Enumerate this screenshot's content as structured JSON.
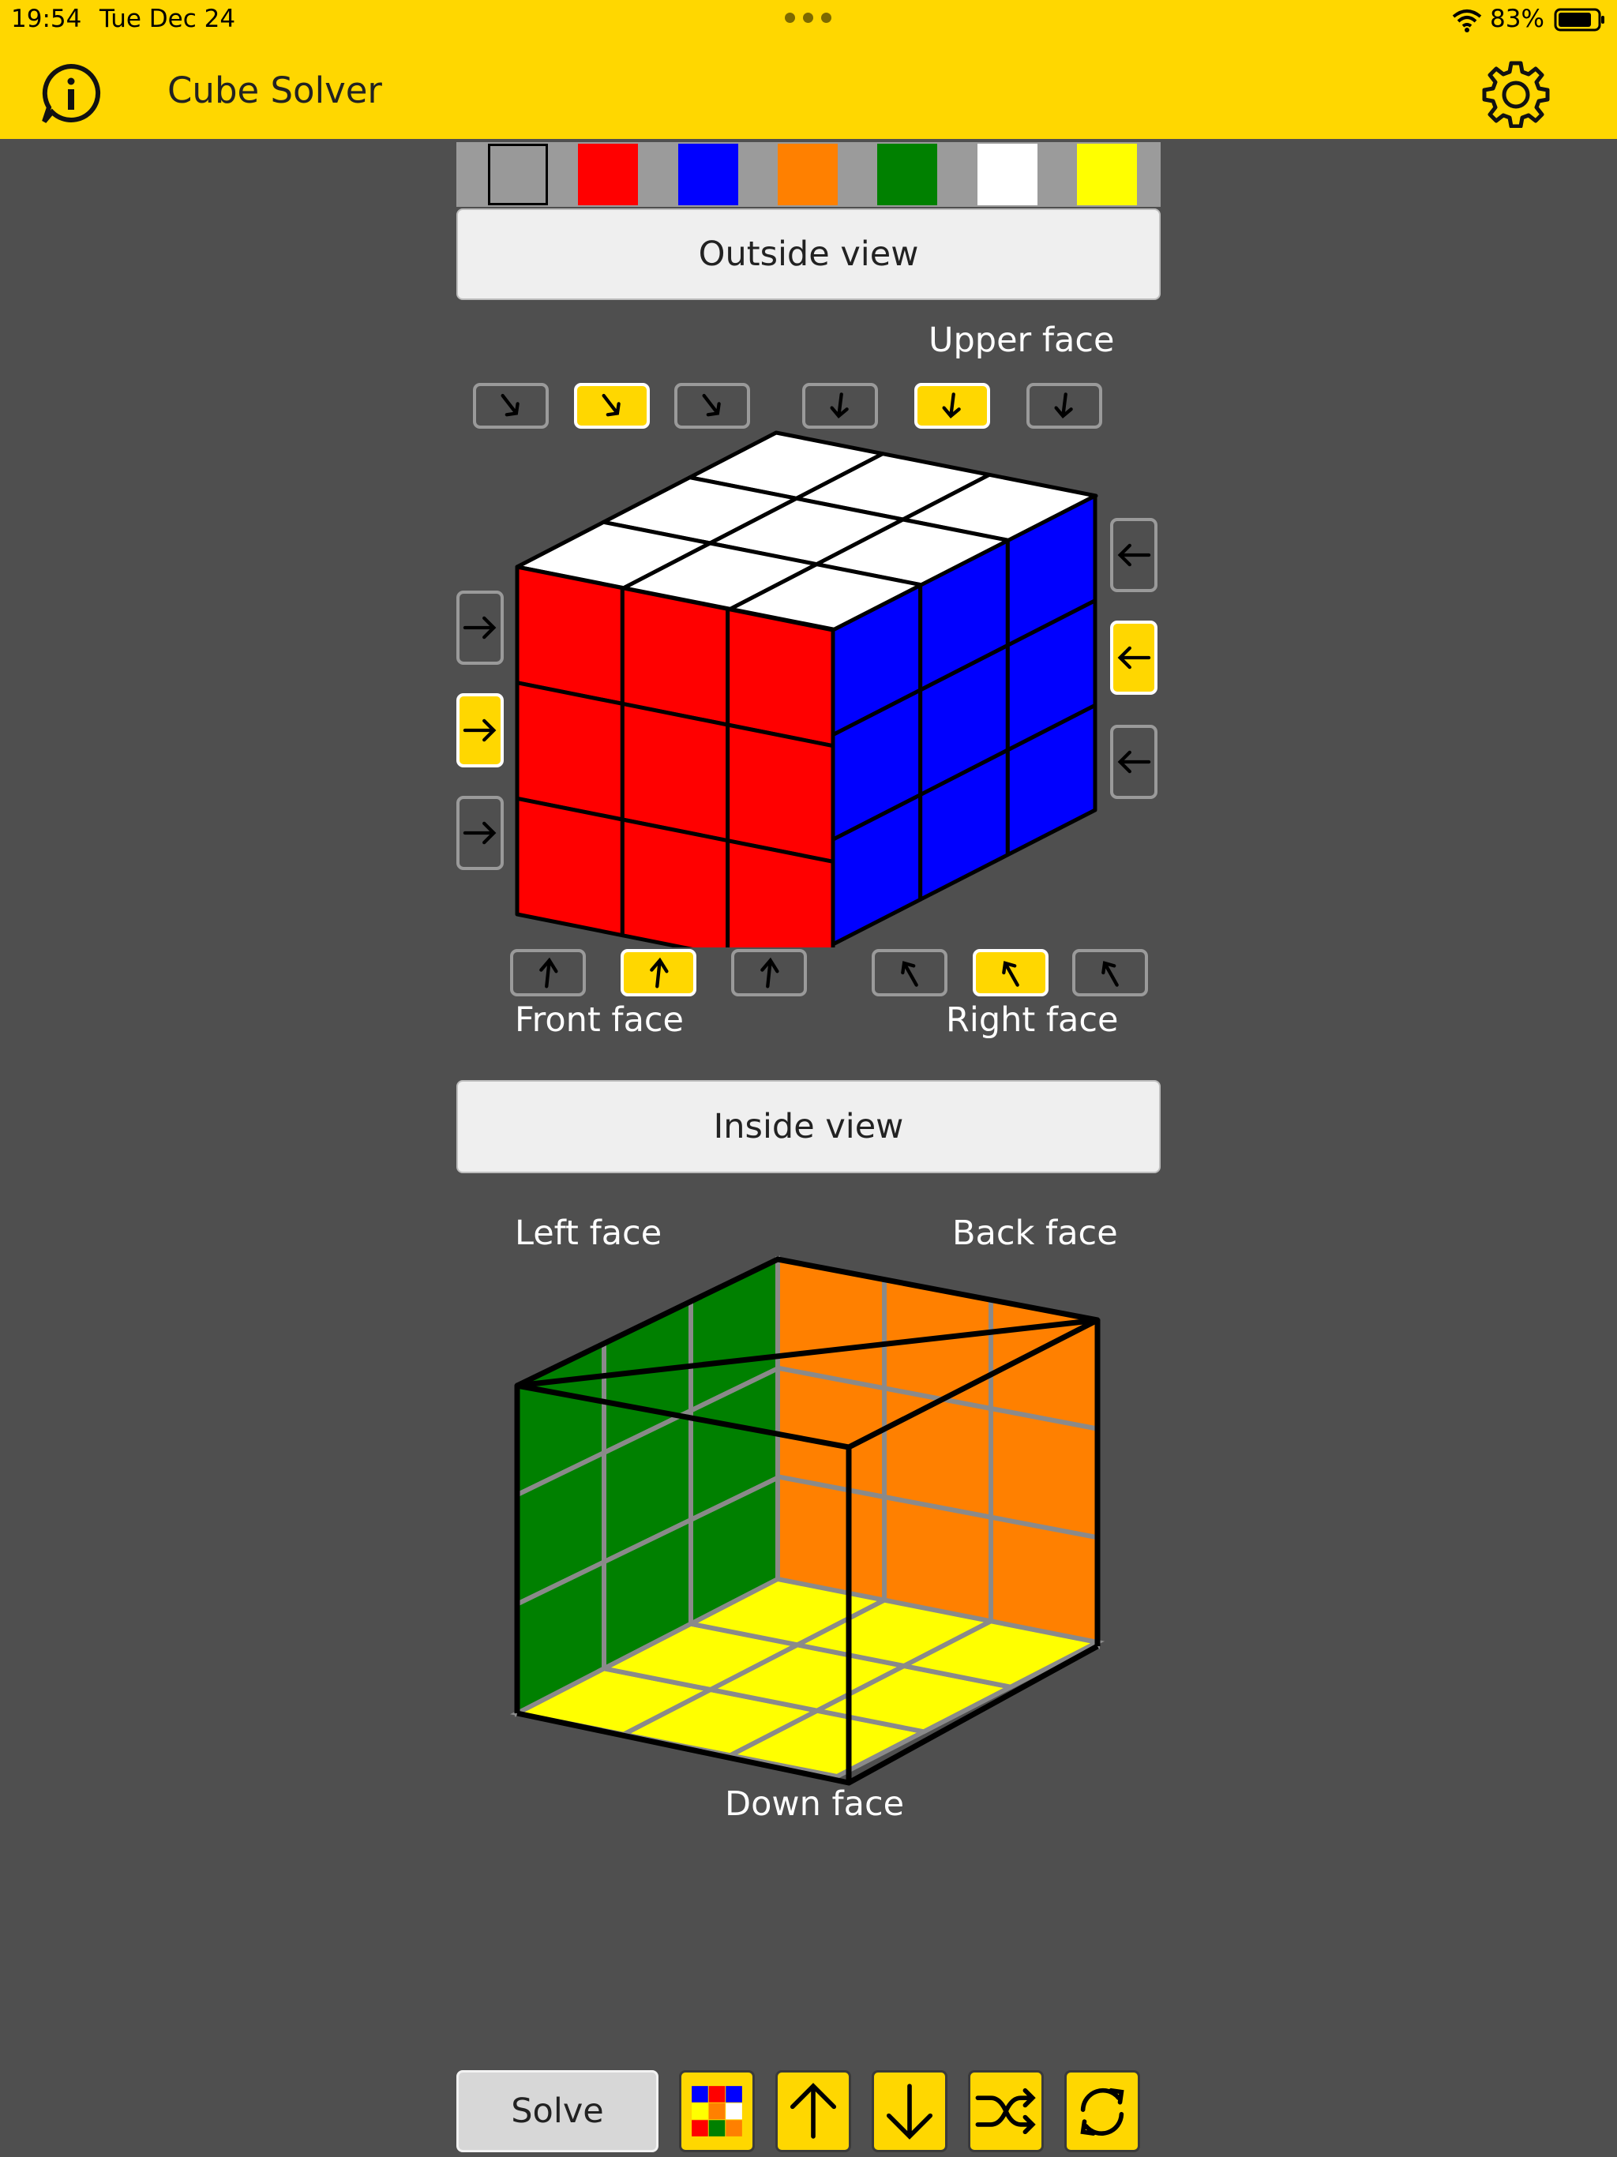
{
  "status_bar": {
    "time": "19:54",
    "date": "Tue Dec 24",
    "battery": "83%"
  },
  "header": {
    "title": "Cube Solver",
    "info_icon": "info-icon",
    "settings_icon": "gear-icon"
  },
  "colors": {
    "accent": "#ffd700",
    "background": "#4f4f4f",
    "palette": [
      "#999999",
      "#ff0000",
      "#0000ff",
      "#ff8000",
      "#008000",
      "#ffffff",
      "#ffff00"
    ]
  },
  "outside_view": {
    "button_label": "Outside view",
    "upper_face_label": "Upper face",
    "front_face_label": "Front face",
    "right_face_label": "Right face",
    "upper_colors": [
      "#ffffff",
      "#ffffff",
      "#ffffff",
      "#ffffff",
      "#ffffff",
      "#ffffff",
      "#ffffff",
      "#ffffff",
      "#ffffff"
    ],
    "front_colors": [
      "#ff0000",
      "#ff0000",
      "#ff0000",
      "#ff0000",
      "#ff0000",
      "#ff0000",
      "#ff0000",
      "#ff0000",
      "#ff0000"
    ],
    "right_colors": [
      "#0000ff",
      "#0000ff",
      "#0000ff",
      "#0000ff",
      "#0000ff",
      "#0000ff",
      "#0000ff",
      "#0000ff",
      "#0000ff"
    ],
    "active_rotation_buttons": [
      "top-diag-2",
      "top-down-2",
      "left-row-2",
      "right-row-2",
      "bottom-up-2",
      "bottom-diag-2"
    ]
  },
  "inside_view": {
    "button_label": "Inside view",
    "left_face_label": "Left face",
    "back_face_label": "Back face",
    "down_face_label": "Down face",
    "left_colors": [
      "#008000",
      "#008000",
      "#008000",
      "#008000",
      "#008000",
      "#008000",
      "#008000",
      "#008000",
      "#008000"
    ],
    "back_colors": [
      "#ff8000",
      "#ff8000",
      "#ff8000",
      "#ff8000",
      "#ff8000",
      "#ff8000",
      "#ff8000",
      "#ff8000",
      "#ff8000"
    ],
    "down_colors": [
      "#ffff00",
      "#ffff00",
      "#ffff00",
      "#ffff00",
      "#ffff00",
      "#ffff00",
      "#ffff00",
      "#ffff00",
      "#ffff00"
    ]
  },
  "toolbar": {
    "solve_label": "Solve",
    "buttons": [
      "colour-grid-icon",
      "arrow-up-icon",
      "arrow-down-icon",
      "shuffle-icon",
      "reset-icon"
    ]
  }
}
